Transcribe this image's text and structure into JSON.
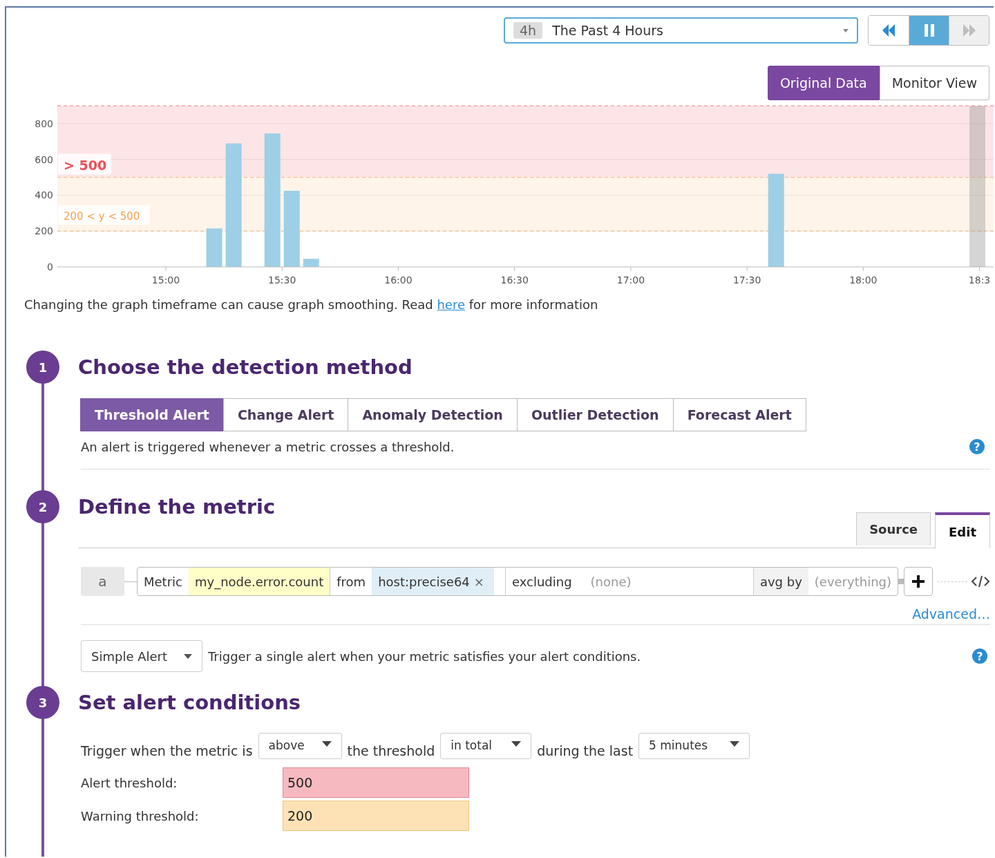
{
  "timeframe": {
    "badge": "4h",
    "value": "The Past 4 Hours"
  },
  "playback": [
    {
      "kind": "rewind",
      "selected": false,
      "disabled": false
    },
    {
      "kind": "pause",
      "selected": true,
      "disabled": false
    },
    {
      "kind": "forward",
      "selected": false,
      "disabled": true
    }
  ],
  "view_toggle": [
    {
      "label": "Original Data",
      "selected": true
    },
    {
      "label": "Monitor View",
      "selected": false
    }
  ],
  "chart": {
    "chart_data": {
      "type": "bar",
      "categories": [
        null,
        null,
        null,
        null,
        null,
        null,
        "15:00",
        null,
        null,
        null,
        null,
        null,
        "15:30",
        null,
        null,
        null,
        null,
        null,
        "16:00",
        null,
        null,
        null,
        null,
        null,
        "16:30",
        null,
        null,
        null,
        null,
        null,
        "17:00",
        null,
        null,
        null,
        null,
        null,
        "17:30",
        null,
        null,
        null,
        null,
        null,
        "18:00",
        null,
        null,
        null,
        null,
        null,
        "18:3"
      ],
      "values": [
        null,
        null,
        null,
        null,
        null,
        null,
        null,
        null,
        215,
        690,
        null,
        745,
        425,
        45,
        null,
        null,
        null,
        null,
        null,
        null,
        null,
        null,
        null,
        null,
        null,
        null,
        null,
        null,
        null,
        null,
        null,
        null,
        null,
        null,
        null,
        null,
        null,
        520,
        null,
        null,
        null,
        null,
        null,
        null,
        null,
        null,
        null,
        null,
        null
      ],
      "ylim": [
        0,
        900
      ],
      "grid": true,
      "ref_lines": [
        {
          "axis": "y",
          "value": 900,
          "color": "#ef4f5b"
        },
        {
          "axis": "y",
          "value": 500,
          "color": "#f7a24e"
        },
        {
          "axis": "y",
          "value": 200,
          "color": "#f7a24e"
        }
      ],
      "yticks": [
        0,
        200,
        400,
        600,
        800
      ],
      "bands": [
        {
          "axis": "y",
          "from": 500,
          "to": 900,
          "label": "> 500",
          "color": "#ef4f5b"
        },
        {
          "axis": "y",
          "from": 200,
          "to": 500,
          "label": "200 < y < 500",
          "color": "#f7a24e"
        }
      ]
    }
  },
  "chart_note": {
    "before": "Changing the graph timeframe can cause graph smoothing. Read",
    "link": "here",
    "after": "for more information"
  },
  "detection": {
    "number": "1",
    "title": "Choose the detection method",
    "tabs": [
      {
        "label": "Threshold Alert",
        "selected": true
      },
      {
        "label": "Change Alert",
        "selected": false
      },
      {
        "label": "Anomaly Detection",
        "selected": false
      },
      {
        "label": "Outlier Detection",
        "selected": false
      },
      {
        "label": "Forecast Alert",
        "selected": false
      }
    ],
    "description": "An alert is triggered whenever a metric crosses a threshold.",
    "help": "?"
  },
  "metric": {
    "number": "2",
    "title": "Define the metric",
    "mode_tabs": [
      {
        "label": "Source",
        "selected": false
      },
      {
        "label": "Edit",
        "selected": true
      }
    ],
    "query": {
      "letter": "a",
      "metric_label": "Metric",
      "metric": "my_node.error.count",
      "from_label": "from",
      "from_tag": "host:precise64",
      "remove": "×",
      "excluding_label": "excluding",
      "excluding": "(none)",
      "avg_label": "avg by",
      "avg": "(everything)"
    },
    "advanced": "Advanced…",
    "alert_type": "Simple Alert",
    "alert_type_description": "Trigger a single alert when your metric satisfies your alert conditions.",
    "help": "?"
  },
  "conditions": {
    "number": "3",
    "title": "Set alert conditions",
    "trigger": {
      "prefix": "Trigger when the metric is",
      "comparison": "above",
      "middle": "the threshold",
      "aggregation": "in total",
      "suffix": "during the last",
      "window": "5 minutes"
    },
    "thresholds": [
      {
        "kind": "alert",
        "label": "Alert threshold:",
        "value": "500"
      },
      {
        "kind": "warning",
        "label": "Warning threshold:",
        "value": "200"
      }
    ]
  }
}
